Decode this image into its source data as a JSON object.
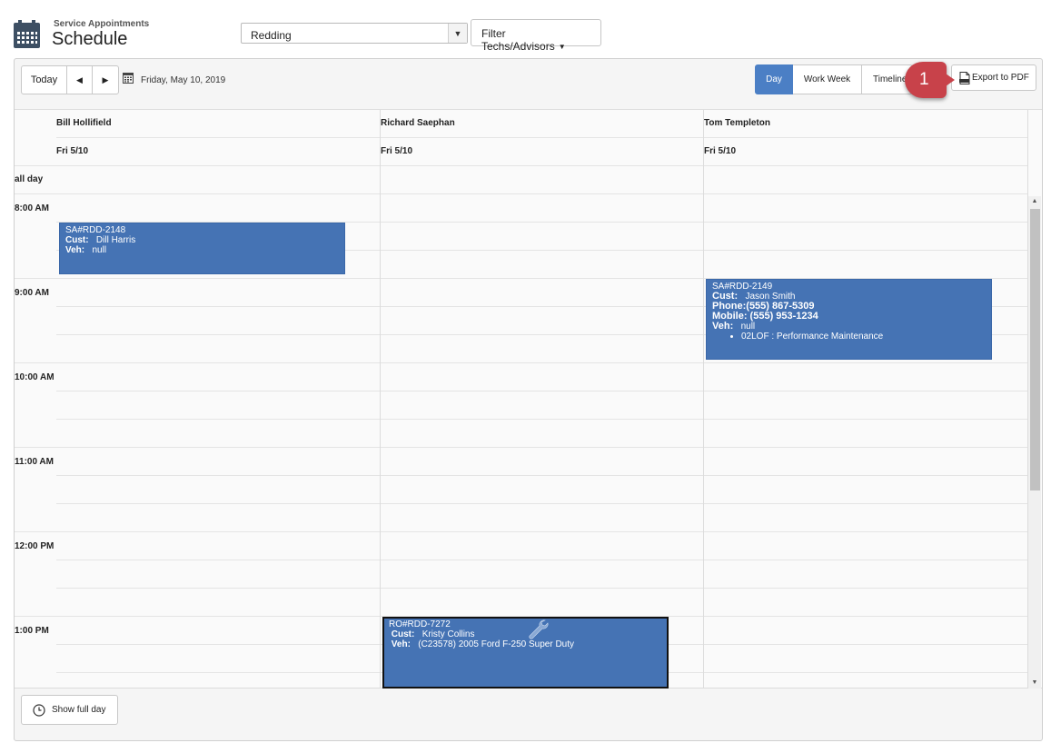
{
  "header": {
    "subtitle": "Service Appointments",
    "title": "Schedule",
    "location": "Redding",
    "filter_label": "Filter Techs/Advisors"
  },
  "toolbar": {
    "today": "Today",
    "date": "Friday, May 10, 2019",
    "views": [
      "Day",
      "Work Week",
      "Timeline"
    ],
    "active_view": "Day",
    "export_label": "Export to PDF",
    "callout_number": "1"
  },
  "columns": [
    {
      "name": "Bill Hollifield",
      "date": "Fri 5/10"
    },
    {
      "name": "Richard Saephan",
      "date": "Fri 5/10"
    },
    {
      "name": "Tom Templeton",
      "date": "Fri 5/10"
    }
  ],
  "all_day_label": "all day",
  "times": [
    "8:00 AM",
    "9:00 AM",
    "10:00 AM",
    "11:00 AM",
    "12:00 PM",
    "1:00 PM"
  ],
  "appointments": [
    {
      "id": "SA#RDD-2148",
      "cust_label": "Cust:",
      "cust": "Dill Harris",
      "veh_label": "Veh:",
      "veh": "null"
    },
    {
      "id": "SA#RDD-2149",
      "cust_label": "Cust:",
      "cust": "Jason Smith",
      "phone": "Phone:(555) 867-5309",
      "mobile": "Mobile: (555) 953-1234",
      "veh_label": "Veh:",
      "veh": "null",
      "service": "02LOF : Performance Maintenance"
    },
    {
      "id": "RO#RDD-7272",
      "cust_label": "Cust:",
      "cust": "Kristy Collins",
      "veh_label": "Veh:",
      "veh": "(C23578) 2005 Ford F-250 Super Duty"
    }
  ],
  "footer": {
    "show_full_day": "Show full day"
  },
  "colors": {
    "accent": "#4b7fc5",
    "appointment": "#4573b4",
    "callout": "#c8424a"
  }
}
